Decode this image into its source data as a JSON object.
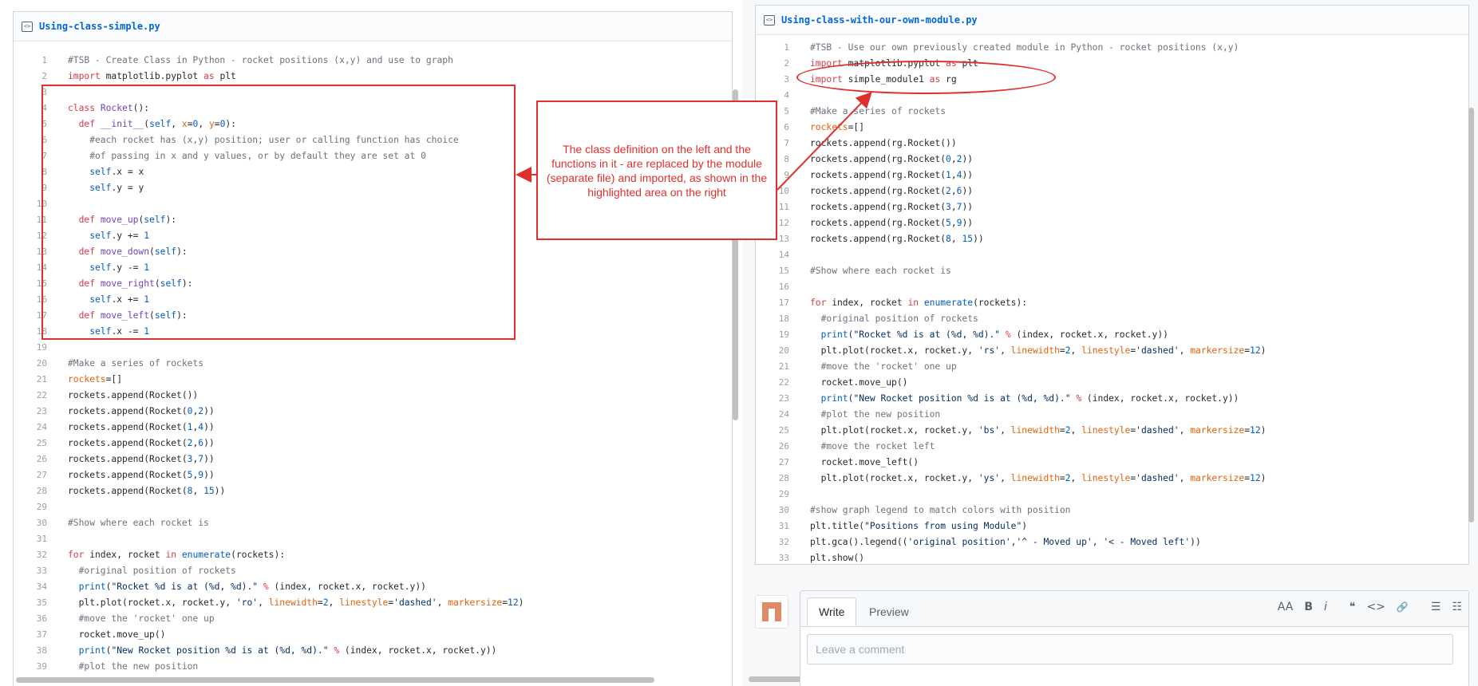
{
  "left": {
    "file_name": "Using-class-simple.py",
    "lines": [
      {
        "n": "1",
        "t": "#TSB - Create Class in Python - rocket positions (x,y) and use to graph"
      },
      {
        "n": "2",
        "t": "import matplotlib.pyplot as plt"
      },
      {
        "n": "3",
        "t": ""
      },
      {
        "n": "4",
        "t": "class Rocket():"
      },
      {
        "n": "5",
        "t": "  def __init__(self, x=0, y=0):"
      },
      {
        "n": "6",
        "t": "    #each rocket has (x,y) position; user or calling function has choice"
      },
      {
        "n": "7",
        "t": "    #of passing in x and y values, or by default they are set at 0"
      },
      {
        "n": "8",
        "t": "    self.x = x"
      },
      {
        "n": "9",
        "t": "    self.y = y"
      },
      {
        "n": "10",
        "t": ""
      },
      {
        "n": "11",
        "t": "  def move_up(self):"
      },
      {
        "n": "12",
        "t": "    self.y += 1"
      },
      {
        "n": "13",
        "t": "  def move_down(self):"
      },
      {
        "n": "14",
        "t": "    self.y -= 1"
      },
      {
        "n": "15",
        "t": "  def move_right(self):"
      },
      {
        "n": "16",
        "t": "    self.x += 1"
      },
      {
        "n": "17",
        "t": "  def move_left(self):"
      },
      {
        "n": "18",
        "t": "    self.x -= 1"
      },
      {
        "n": "19",
        "t": ""
      },
      {
        "n": "20",
        "t": "#Make a series of rockets"
      },
      {
        "n": "21",
        "t": "rockets=[]"
      },
      {
        "n": "22",
        "t": "rockets.append(Rocket())"
      },
      {
        "n": "23",
        "t": "rockets.append(Rocket(0,2))"
      },
      {
        "n": "24",
        "t": "rockets.append(Rocket(1,4))"
      },
      {
        "n": "25",
        "t": "rockets.append(Rocket(2,6))"
      },
      {
        "n": "26",
        "t": "rockets.append(Rocket(3,7))"
      },
      {
        "n": "27",
        "t": "rockets.append(Rocket(5,9))"
      },
      {
        "n": "28",
        "t": "rockets.append(Rocket(8, 15))"
      },
      {
        "n": "29",
        "t": ""
      },
      {
        "n": "30",
        "t": "#Show where each rocket is"
      },
      {
        "n": "31",
        "t": ""
      },
      {
        "n": "32",
        "t": "for index, rocket in enumerate(rockets):"
      },
      {
        "n": "33",
        "t": "  #original position of rockets"
      },
      {
        "n": "34",
        "t": "  print(\"Rocket %d is at (%d, %d).\" % (index, rocket.x, rocket.y))"
      },
      {
        "n": "35",
        "t": "  plt.plot(rocket.x, rocket.y, 'ro', linewidth=2, linestyle='dashed', markersize=12)"
      },
      {
        "n": "36",
        "t": "  #move the 'rocket' one up"
      },
      {
        "n": "37",
        "t": "  rocket.move_up()"
      },
      {
        "n": "38",
        "t": "  print(\"New Rocket position %d is at (%d, %d).\" % (index, rocket.x, rocket.y))"
      },
      {
        "n": "39",
        "t": "  #plot the new position"
      }
    ]
  },
  "right": {
    "file_name": "Using-class-with-our-own-module.py",
    "lines": [
      {
        "n": "1",
        "t": "#TSB - Use our own previously created module in Python - rocket positions (x,y)"
      },
      {
        "n": "2",
        "t": "import matplotlib.pyplot as plt"
      },
      {
        "n": "3",
        "t": "import simple_module1 as rg"
      },
      {
        "n": "4",
        "t": ""
      },
      {
        "n": "5",
        "t": "#Make a series of rockets"
      },
      {
        "n": "6",
        "t": "rockets=[]"
      },
      {
        "n": "7",
        "t": "rockets.append(rg.Rocket())"
      },
      {
        "n": "8",
        "t": "rockets.append(rg.Rocket(0,2))"
      },
      {
        "n": "9",
        "t": "rockets.append(rg.Rocket(1,4))"
      },
      {
        "n": "10",
        "t": "rockets.append(rg.Rocket(2,6))"
      },
      {
        "n": "11",
        "t": "rockets.append(rg.Rocket(3,7))"
      },
      {
        "n": "12",
        "t": "rockets.append(rg.Rocket(5,9))"
      },
      {
        "n": "13",
        "t": "rockets.append(rg.Rocket(8, 15))"
      },
      {
        "n": "14",
        "t": ""
      },
      {
        "n": "15",
        "t": "#Show where each rocket is"
      },
      {
        "n": "16",
        "t": ""
      },
      {
        "n": "17",
        "t": "for index, rocket in enumerate(rockets):"
      },
      {
        "n": "18",
        "t": "  #original position of rockets"
      },
      {
        "n": "19",
        "t": "  print(\"Rocket %d is at (%d, %d).\" % (index, rocket.x, rocket.y))"
      },
      {
        "n": "20",
        "t": "  plt.plot(rocket.x, rocket.y, 'rs', linewidth=2, linestyle='dashed', markersize=12)"
      },
      {
        "n": "21",
        "t": "  #move the 'rocket' one up"
      },
      {
        "n": "22",
        "t": "  rocket.move_up()"
      },
      {
        "n": "23",
        "t": "  print(\"New Rocket position %d is at (%d, %d).\" % (index, rocket.x, rocket.y))"
      },
      {
        "n": "24",
        "t": "  #plot the new position"
      },
      {
        "n": "25",
        "t": "  plt.plot(rocket.x, rocket.y, 'bs', linewidth=2, linestyle='dashed', markersize=12)"
      },
      {
        "n": "26",
        "t": "  #move the rocket left"
      },
      {
        "n": "27",
        "t": "  rocket.move_left()"
      },
      {
        "n": "28",
        "t": "  plt.plot(rocket.x, rocket.y, 'ys', linewidth=2, linestyle='dashed', markersize=12)"
      },
      {
        "n": "29",
        "t": ""
      },
      {
        "n": "30",
        "t": "#show graph legend to match colors with position"
      },
      {
        "n": "31",
        "t": "plt.title(\"Positions from using Module\")"
      },
      {
        "n": "32",
        "t": "plt.gca().legend(('original position','^ - Moved up', '< - Moved left'))"
      },
      {
        "n": "33",
        "t": "plt.show()"
      }
    ]
  },
  "annotation": {
    "callout_text": "The class definition on the left and the functions in it - are replaced by the module (separate file) and imported, as shown in the highlighted area on the right",
    "color": "#e0302d"
  },
  "comment": {
    "write_tab": "Write",
    "preview_tab": "Preview",
    "placeholder": "Leave a comment",
    "toolbar": {
      "heading": "AA",
      "bold": "B",
      "italic": "i",
      "quote": "❝",
      "code": "<>",
      "link": "🔗",
      "bulleted_list": "☰",
      "numbered_list": "☷"
    }
  },
  "icons": {
    "file_code": "file-code-icon",
    "avatar": "identicon-avatar"
  },
  "colors": {
    "comment": "#6a737d",
    "keyword": "#d73a49",
    "function": "#6f42c1",
    "builtin": "#005cc5",
    "string": "#032f62",
    "kwarg": "#e36209",
    "link": "#0366d6"
  }
}
